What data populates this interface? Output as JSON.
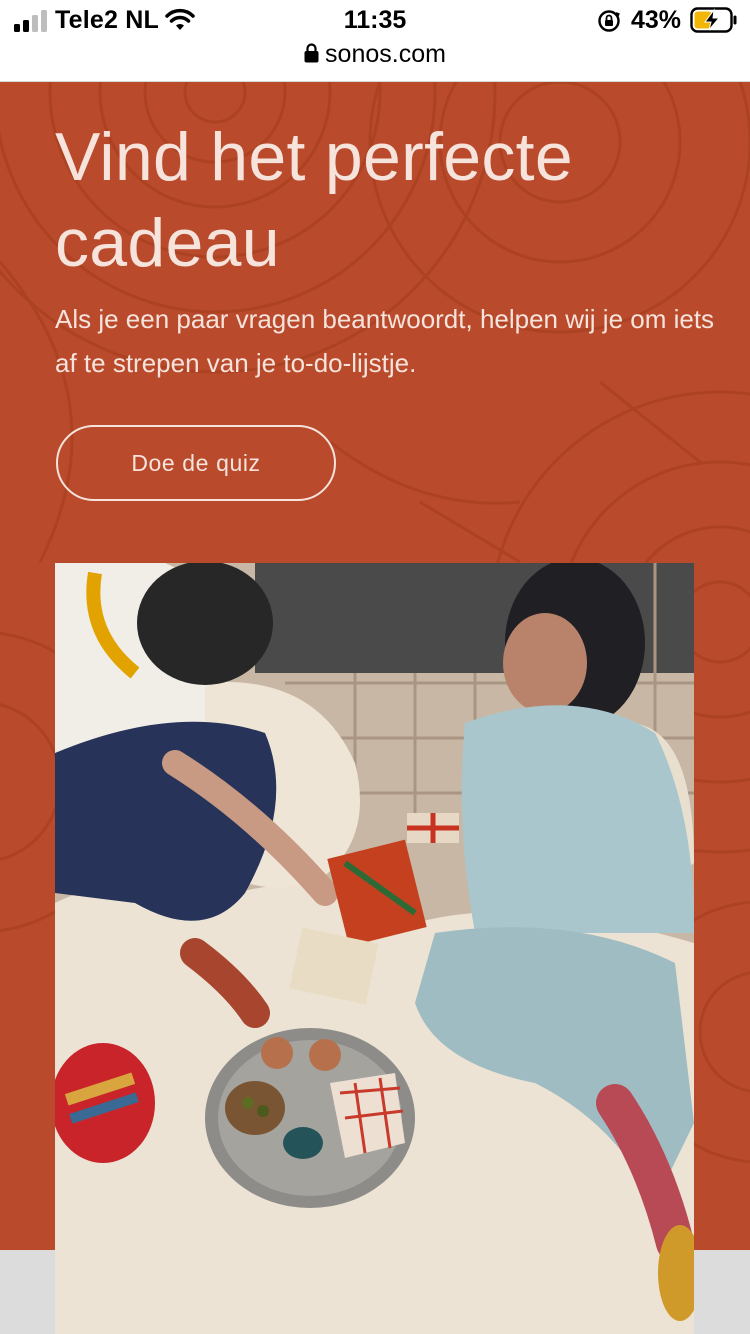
{
  "status": {
    "carrier": "Tele2 NL",
    "time": "11:35",
    "battery": "43%"
  },
  "browser": {
    "url": "sonos.com"
  },
  "hero": {
    "title": "Vind het perfecte cadeau",
    "subtitle": "Als je een paar vragen beantwoordt, helpen wij je om iets af te strepen van je to-do-lijstje.",
    "cta_label": "Doe de quiz",
    "background_color": "#b94a2c",
    "text_color": "#f6e3dc"
  },
  "icons": [
    "signal-icon",
    "wifi-icon",
    "rotation-lock-icon",
    "battery-charging-icon",
    "lock-icon"
  ]
}
